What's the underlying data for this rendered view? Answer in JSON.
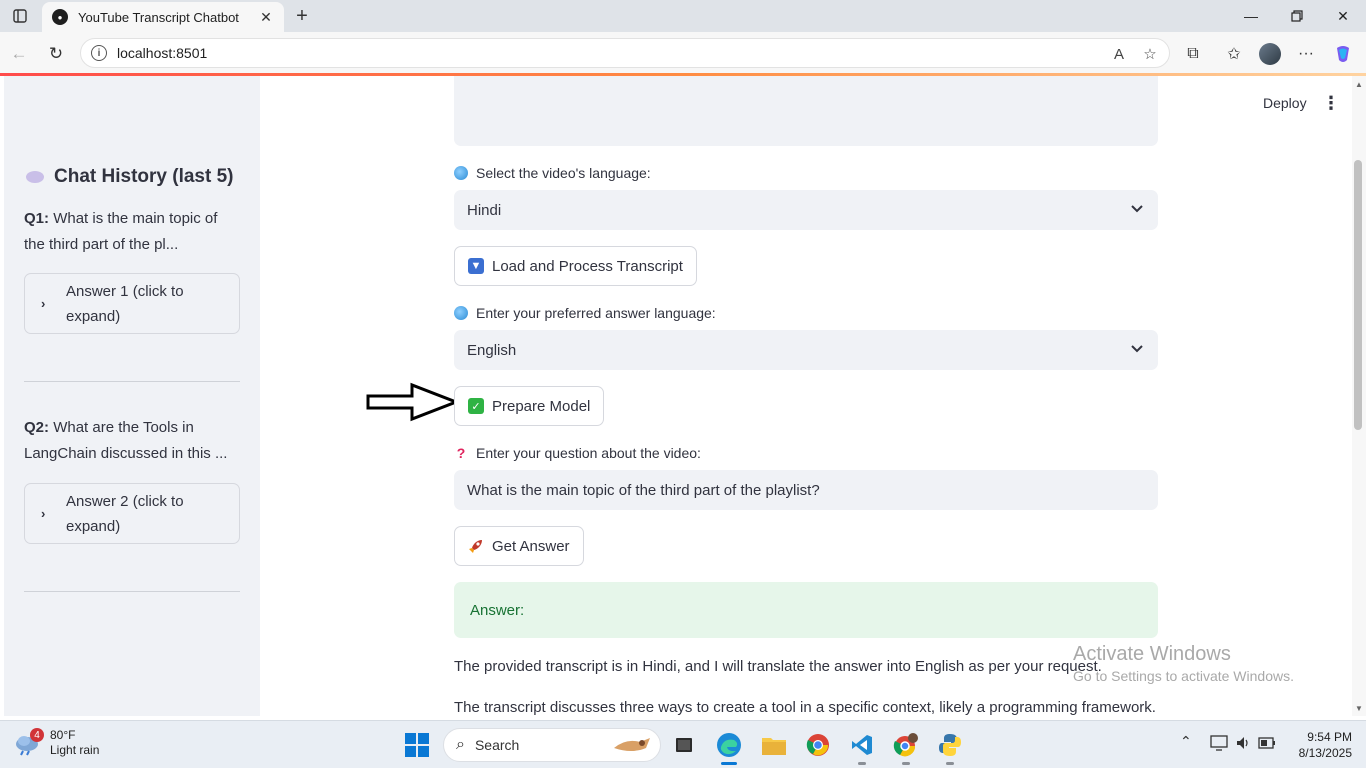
{
  "browser": {
    "tab_title": "YouTube Transcript Chatbot",
    "url": "localhost:8501"
  },
  "app": {
    "header": {
      "deploy_label": "Deploy"
    },
    "sidebar": {
      "title": "Chat History (last 5)",
      "items": [
        {
          "q_label": "Q1:",
          "q_text": "What is the main topic of the third part of the pl...",
          "answer_label": "Answer 1 (click to expand)"
        },
        {
          "q_label": "Q2:",
          "q_text": "What are the Tools in LangChain discussed in this ...",
          "answer_label": "Answer 2 (click to expand)"
        }
      ]
    },
    "main": {
      "video_language_label": "Select the video's language:",
      "video_language_value": "Hindi",
      "load_button": "Load and Process Transcript",
      "answer_language_label": "Enter your preferred answer language:",
      "answer_language_value": "English",
      "prepare_button": "Prepare Model",
      "question_label": "Enter your question about the video:",
      "question_value": "What is the main topic of the third part of the playlist?",
      "get_answer_button": "Get Answer",
      "answer_heading": "Answer:",
      "answer_paragraphs": [
        "The provided transcript is in Hindi, and I will translate the answer into English as per your request.",
        "The transcript discusses three ways to create a tool in a specific context, likely a programming framework."
      ]
    }
  },
  "os": {
    "watermark_title": "Activate Windows",
    "watermark_sub": "Go to Settings to activate Windows.",
    "weather": {
      "badge": "4",
      "temp": "80°F",
      "condition": "Light rain"
    },
    "search_placeholder": "Search",
    "time": "9:54 PM",
    "date": "8/13/2025"
  },
  "colors": {
    "sidebar_bg": "#f0f2f6",
    "input_bg": "#f0f2f6",
    "success_bg": "#e6f6ea",
    "success_text": "#177233",
    "accent": "#ff4b4b"
  }
}
